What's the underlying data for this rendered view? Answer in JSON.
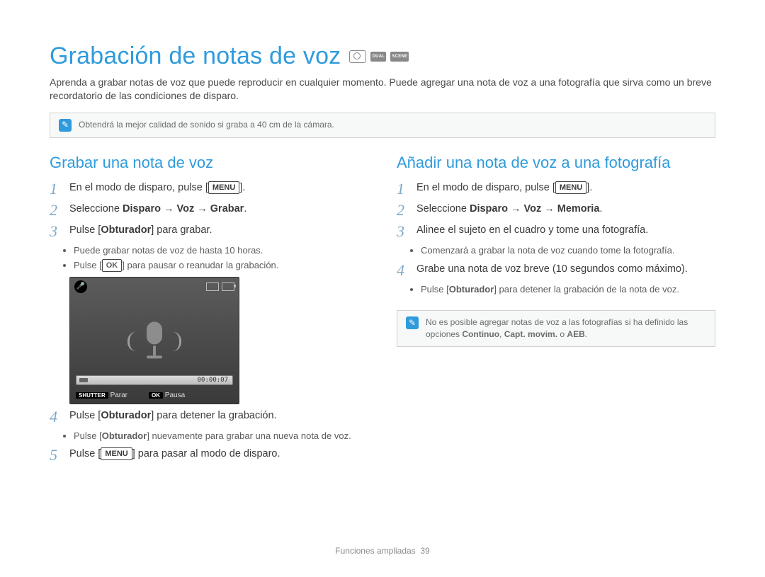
{
  "title": "Grabación de notas de voz",
  "intro": "Aprenda a grabar notas de voz que puede reproducir en cualquier momento. Puede agregar una nota de voz a una fotografía que sirva como un breve recordatorio de las condiciones de disparo.",
  "note_top": "Obtendrá la mejor calidad de sonido si graba a 40 cm de la cámara.",
  "footer": {
    "section": "Funciones ampliadas",
    "page": "39"
  },
  "mode_icons": {
    "dual": "DUAL",
    "scene": "SCENE"
  },
  "keycaps": {
    "menu": "MENU",
    "ok": "OK"
  },
  "left": {
    "heading": "Grabar una nota de voz",
    "s1_a": "En el modo de disparo, pulse [",
    "s1_b": "].",
    "s2_a": "Seleccione ",
    "s2_b": "Disparo → Voz → Grabar",
    "s2_c": ".",
    "s3_a": "Pulse [",
    "s3_b": "Obturador",
    "s3_c": "] para grabar.",
    "s3_bullet1": "Puede grabar notas de voz de hasta 10 horas.",
    "s3_bullet2a": "Pulse [",
    "s3_bullet2b": "] para pausar o reanudar la grabación.",
    "s4_a": "Pulse [",
    "s4_b": "Obturador",
    "s4_c": "] para detener la grabación.",
    "s4_bullet_a": "Pulse [",
    "s4_bullet_b": "Obturador",
    "s4_bullet_c": "] nuevamente para grabar una nueva nota de voz.",
    "s5_a": "Pulse [",
    "s5_b": "] para pasar al modo de disparo."
  },
  "screen": {
    "timer": "00:00:07",
    "shutter_key": "SHUTTER",
    "shutter_label": "Parar",
    "ok_key": "OK",
    "ok_label": "Pausa"
  },
  "right": {
    "heading": "Añadir una nota de voz a una fotografía",
    "s1_a": "En el modo de disparo, pulse [",
    "s1_b": "].",
    "s2_a": "Seleccione ",
    "s2_b": "Disparo → Voz → Memoria",
    "s2_c": ".",
    "s3": "Alinee el sujeto en el cuadro y tome una fotografía.",
    "s3_bullet": "Comenzará a grabar la nota de voz cuando tome la fotografía.",
    "s4": "Grabe una nota de voz breve (10 segundos como máximo).",
    "s4_bullet_a": "Pulse [",
    "s4_bullet_b": "Obturador",
    "s4_bullet_c": "] para detener la grabación de la nota de voz.",
    "note_a": "No es posible agregar notas de voz a las fotografías si ha definido las opciones ",
    "note_b": "Continuo",
    "note_c": ", ",
    "note_d": "Capt. movim.",
    "note_e": " o ",
    "note_f": "AEB",
    "note_g": "."
  }
}
